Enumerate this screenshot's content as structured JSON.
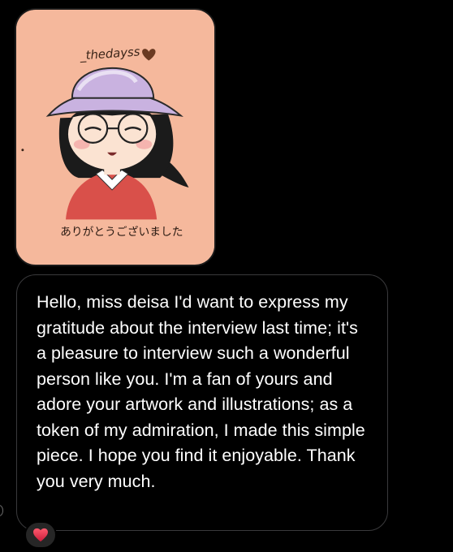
{
  "image_message": {
    "signature_text": "_thedayss",
    "caption_text": "ありがとうございました",
    "colors": {
      "background": "#f5b89c",
      "hat": "#c9b2e0",
      "shirt": "#d9504a",
      "hair": "#1b1b1b",
      "skin": "#fbe3d2"
    }
  },
  "message": {
    "text": "Hello, miss deisa I'd want to express my gratitude about the interview last time; it's a pleasure to interview such a wonderful person like you. I'm a fan of yours and adore your artwork and illustrations; as a token of my admiration, I made this simple piece. I hope you find it enjoyable. Thank you very much."
  },
  "reaction": {
    "icon": "red-heart-icon",
    "color": "#e0245e"
  }
}
